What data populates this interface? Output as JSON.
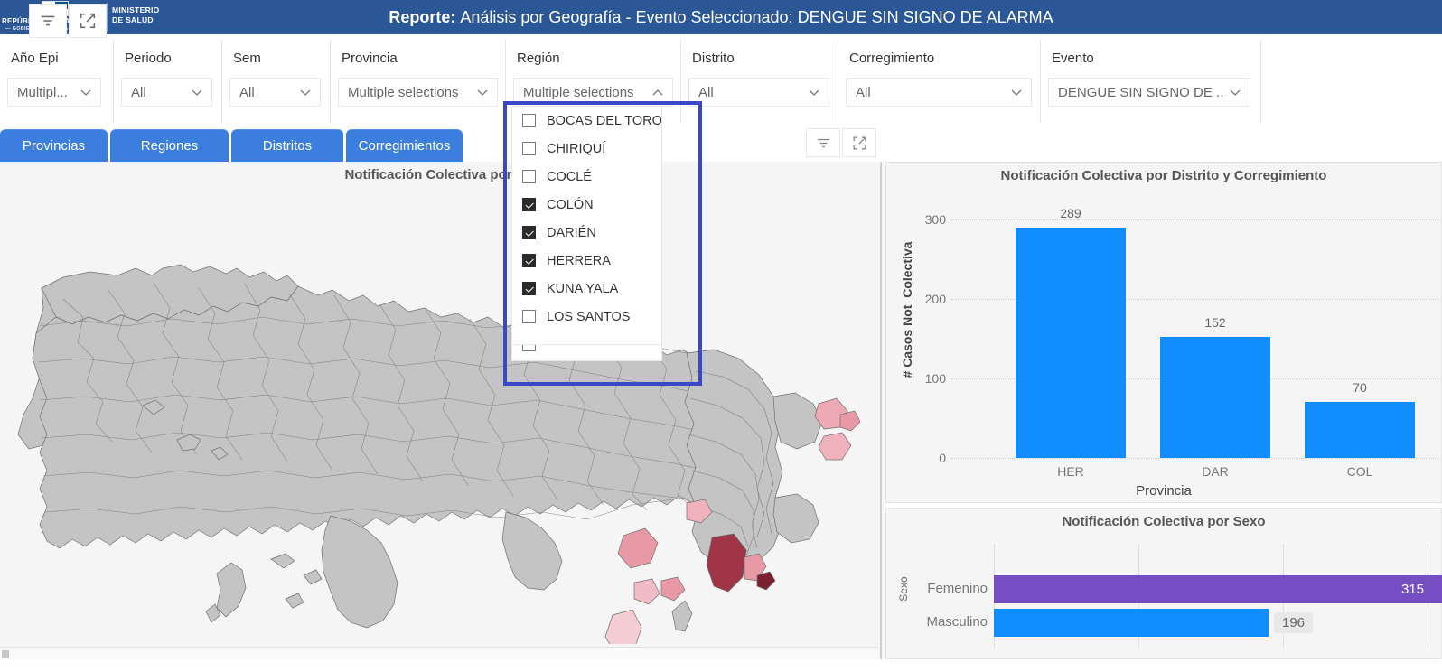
{
  "header": {
    "republic_line1": "REPÚBLICA DE PANAMÁ",
    "republic_line2": "— GOBIERNO NACIONAL —",
    "ministry": "MINISTERIO\nDE SALUD",
    "ministry_line1": "MINISTERIO",
    "ministry_line2": "DE SALUD",
    "title_prefix": "Reporte:",
    "title_text": "Análisis por Geografía - Evento Seleccionado: DENGUE SIN SIGNO DE ALARMA",
    "bg_color": "#2b5797"
  },
  "header_buttons": [
    {
      "name": "filter-icon",
      "tooltip": "Filtros"
    },
    {
      "name": "focus-mode-icon",
      "tooltip": "Modo de enfoque"
    }
  ],
  "slicers": [
    {
      "label": "Año Epi",
      "value": "Multipl...",
      "state": "collapsed"
    },
    {
      "label": "Periodo",
      "value": "All",
      "state": "collapsed"
    },
    {
      "label": "Sem",
      "value": "All",
      "state": "collapsed"
    },
    {
      "label": "Provincia",
      "value": "Multiple selections",
      "state": "collapsed"
    },
    {
      "label": "Región",
      "value": "Multiple selections",
      "state": "expanded"
    },
    {
      "label": "Distrito",
      "value": "All",
      "state": "collapsed"
    },
    {
      "label": "Corregimiento",
      "value": "All",
      "state": "collapsed"
    },
    {
      "label": "Evento",
      "value": "DENGUE SIN SIGNO DE ...",
      "state": "collapsed"
    }
  ],
  "tabs": [
    {
      "label": "Provincias"
    },
    {
      "label": "Regiones"
    },
    {
      "label": "Distritos"
    },
    {
      "label": "Corregimientos"
    }
  ],
  "region_dropdown": {
    "items": [
      {
        "label": "BOCAS DEL TORO",
        "checked": false
      },
      {
        "label": "CHIRIQUÍ",
        "checked": false
      },
      {
        "label": "COCLÉ",
        "checked": false
      },
      {
        "label": "COLÓN",
        "checked": true
      },
      {
        "label": "DARIÉN",
        "checked": true
      },
      {
        "label": "HERRERA",
        "checked": true
      },
      {
        "label": "KUNA YALA",
        "checked": true
      },
      {
        "label": "LOS SANTOS",
        "checked": false
      }
    ],
    "clipped_item": {
      "label": "",
      "checked": false
    },
    "highlight_color": "#3a47c8"
  },
  "map_panel": {
    "title": "Notificación Colectiva por Cor",
    "title_full": "Notificación Colectiva por Corregimiento",
    "base_color": "#c4c4c4",
    "highlight_colors": [
      "#f5b9c1",
      "#e79aa6",
      "#d48490",
      "#a33c4e",
      "#8e2b3d"
    ]
  },
  "map_toolbar": [
    {
      "name": "filter-icon"
    },
    {
      "name": "focus-mode-icon"
    }
  ],
  "chart_data": [
    {
      "type": "bar",
      "title": "Notificación Colectiva por Distrito y Corregimiento",
      "xlabel": "Provincia",
      "ylabel": "# Casos Not_Colectiva",
      "categories": [
        "HER",
        "DAR",
        "COL"
      ],
      "values": [
        289,
        152,
        70
      ],
      "yticks": [
        0,
        100,
        200,
        300
      ],
      "ylim": [
        0,
        320
      ],
      "grid": true,
      "legend": "none",
      "series_color": "#118DFF"
    },
    {
      "type": "bar",
      "orientation": "horizontal",
      "title": "Notificación Colectiva por Sexo",
      "xlabel": "",
      "ylabel": "Sexo",
      "categories": [
        "Femenino",
        "Masculino"
      ],
      "values": [
        315,
        196
      ],
      "colors": [
        "#744EC2",
        "#118DFF"
      ],
      "xlim": [
        0,
        330
      ],
      "grid": true,
      "legend": "none"
    }
  ]
}
